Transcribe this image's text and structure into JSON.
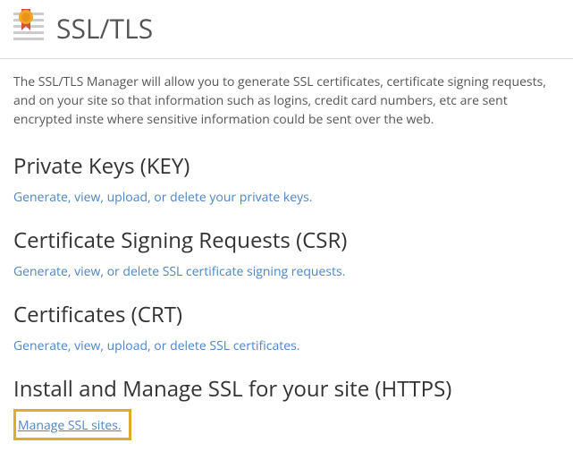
{
  "header": {
    "title": "SSL/TLS"
  },
  "description": "The SSL/TLS Manager will allow you to generate SSL certificates, certificate signing requests, and on your site so that information such as logins, credit card numbers, etc are sent encrypted inste where sensitive information could be sent over the web.",
  "sections": {
    "private_keys": {
      "heading": "Private Keys (KEY)",
      "link": "Generate, view, upload, or delete your private keys."
    },
    "csr": {
      "heading": "Certificate Signing Requests (CSR)",
      "link": "Generate, view, or delete SSL certificate signing requests."
    },
    "crt": {
      "heading": "Certificates (CRT)",
      "link": "Generate, view, upload, or delete SSL certificates."
    },
    "install": {
      "heading": "Install and Manage SSL for your site (HTTPS)",
      "link": "Manage SSL sites."
    }
  }
}
